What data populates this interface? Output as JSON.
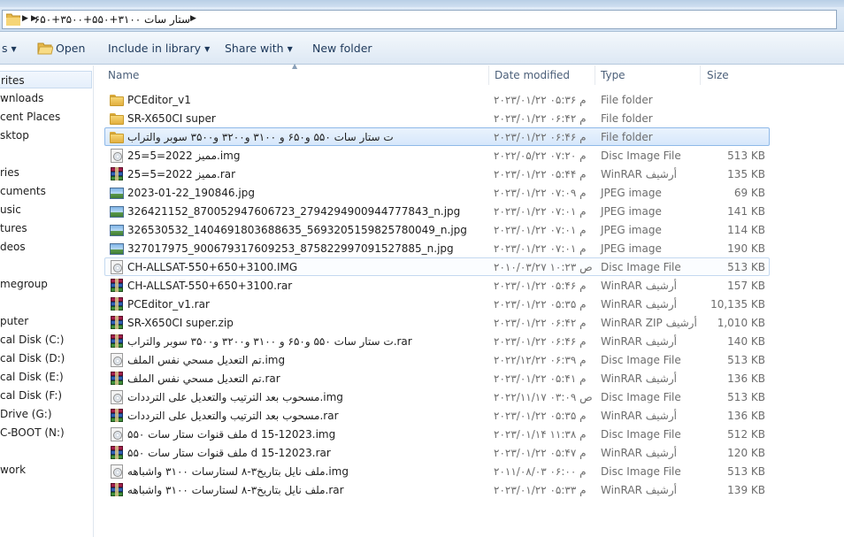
{
  "address_bar": {
    "path": "ستار سات ۳۱۰۰+۵۵۰+۳۵۰۰+۶۵۰"
  },
  "toolbar": {
    "partial_left_label": "s",
    "open_label": "Open",
    "include_label": "Include in library",
    "share_label": "Share with",
    "new_folder_label": "New folder"
  },
  "nav_pane": {
    "items": [
      {
        "label": "rites",
        "selected": true
      },
      {
        "label": "wnloads"
      },
      {
        "label": "cent Places"
      },
      {
        "label": "sktop"
      },
      {
        "label": ""
      },
      {
        "label": "ries"
      },
      {
        "label": "cuments"
      },
      {
        "label": "usic"
      },
      {
        "label": "tures"
      },
      {
        "label": "deos"
      },
      {
        "label": ""
      },
      {
        "label": "megroup"
      },
      {
        "label": ""
      },
      {
        "label": "puter"
      },
      {
        "label": "cal Disk (C:)"
      },
      {
        "label": "cal Disk (D:)"
      },
      {
        "label": "cal Disk (E:)"
      },
      {
        "label": "cal Disk (F:)"
      },
      {
        "label": "Drive (G:)"
      },
      {
        "label": "C-BOOT (N:)"
      },
      {
        "label": ""
      },
      {
        "label": "work"
      }
    ]
  },
  "columns": {
    "name": "Name",
    "date": "Date modified",
    "type": "Type",
    "size": "Size"
  },
  "files": [
    {
      "icon": "folder",
      "name": "PCEditor_v1",
      "date": "۲۰۲۳/۰۱/۲۲ م ۰۵:۳۶",
      "type": "File folder",
      "size": ""
    },
    {
      "icon": "folder",
      "name": "SR-X650CI super",
      "date": "۲۰۲۳/۰۱/۲۲ م ۰۶:۴۲",
      "type": "File folder",
      "size": ""
    },
    {
      "icon": "folder",
      "name": "ت ستار سات ۵۵۰ و۶۵۰ و ۳۱۰۰ و۳۲۰۰ و۳۵۰۰ سوبر والتراب",
      "date": "۲۰۲۳/۰۱/۲۲ م ۰۶:۴۶",
      "type": "File folder",
      "size": "",
      "state": "selected"
    },
    {
      "icon": "disc",
      "name": "مميز 2022=5=25.img",
      "date": "۲۰۲۲/۰۵/۲۲ م ۰۷:۲۰",
      "type": "Disc Image File",
      "size": "513 KB"
    },
    {
      "icon": "rar",
      "name": "مميز 2022=5=25.rar",
      "date": "۲۰۲۳/۰۱/۲۲ م ۰۵:۴۴",
      "type": "WinRAR أرشيف",
      "size": "135 KB"
    },
    {
      "icon": "jpg",
      "name": "2023-01-22_190846.jpg",
      "date": "۲۰۲۳/۰۱/۲۲ م ۰۷:۰۹",
      "type": "JPEG image",
      "size": "69 KB"
    },
    {
      "icon": "jpg",
      "name": "326421152_870052947606723_2794294900944777843_n.jpg",
      "date": "۲۰۲۳/۰۱/۲۲ م ۰۷:۰۱",
      "type": "JPEG image",
      "size": "141 KB"
    },
    {
      "icon": "jpg",
      "name": "326530532_1404691803688635_5693205159825780049_n.jpg",
      "date": "۲۰۲۳/۰۱/۲۲ م ۰۷:۰۱",
      "type": "JPEG image",
      "size": "114 KB"
    },
    {
      "icon": "jpg",
      "name": "327017975_900679317609253_875822997091527885_n.jpg",
      "date": "۲۰۲۳/۰۱/۲۲ م ۰۷:۰۱",
      "type": "JPEG image",
      "size": "190 KB"
    },
    {
      "icon": "disc",
      "name": "CH-ALLSAT-550+650+3100.IMG",
      "date": "۲۰۱۰/۰۳/۲۷ ص ۱۰:۲۳",
      "type": "Disc Image File",
      "size": "513 KB",
      "state": "hover"
    },
    {
      "icon": "rar",
      "name": "CH-ALLSAT-550+650+3100.rar",
      "date": "۲۰۲۳/۰۱/۲۲ م ۰۵:۴۶",
      "type": "WinRAR أرشيف",
      "size": "157 KB"
    },
    {
      "icon": "rar",
      "name": "PCEditor_v1.rar",
      "date": "۲۰۲۳/۰۱/۲۲ م ۰۵:۳۵",
      "type": "WinRAR أرشيف",
      "size": "10,135 KB"
    },
    {
      "icon": "rar",
      "name": "SR-X650CI super.zip",
      "date": "۲۰۲۳/۰۱/۲۲ م ۰۶:۴۲",
      "type": "WinRAR ZIP أرشيف",
      "size": "1,010 KB"
    },
    {
      "icon": "rar",
      "name": "ت ستار سات ۵۵۰ و۶۵۰ و ۳۱۰۰ و۳۲۰۰ و۳۵۰۰ سوبر والتراب.rar",
      "date": "۲۰۲۳/۰۱/۲۲ م ۰۶:۴۶",
      "type": "WinRAR أرشيف",
      "size": "140 KB"
    },
    {
      "icon": "disc",
      "name": "تم التعديل مسحي نفس الملف.img",
      "date": "۲۰۲۲/۱۲/۲۲ م ۰۶:۳۹",
      "type": "Disc Image File",
      "size": "513 KB"
    },
    {
      "icon": "rar",
      "name": "تم التعديل مسحي نفس الملف.rar",
      "date": "۲۰۲۳/۰۱/۲۲ م ۰۵:۴۱",
      "type": "WinRAR أرشيف",
      "size": "136 KB"
    },
    {
      "icon": "disc",
      "name": "مسحوب بعد الترتيب والتعديل على الترددات.img",
      "date": "۲۰۲۲/۱۱/۱۷ ص ۰۳:۰۹",
      "type": "Disc Image File",
      "size": "513 KB"
    },
    {
      "icon": "rar",
      "name": "مسحوب بعد الترتيب والتعديل على الترددات.rar",
      "date": "۲۰۲۳/۰۱/۲۲ م ۰۵:۳۵",
      "type": "WinRAR أرشيف",
      "size": "136 KB"
    },
    {
      "icon": "disc",
      "name": "ملف قنوات ستار سات ۵۵۰ d 15-12023.img",
      "date": "۲۰۲۳/۰۱/۱۴ م ۱۱:۳۸",
      "type": "Disc Image File",
      "size": "512 KB"
    },
    {
      "icon": "rar",
      "name": "ملف قنوات ستار سات ۵۵۰ d 15-12023.rar",
      "date": "۲۰۲۳/۰۱/۲۲ م ۰۵:۴۷",
      "type": "WinRAR أرشيف",
      "size": "120 KB"
    },
    {
      "icon": "disc",
      "name": "ملف نايل بتاريخ۳-۸ لستارسات ۳۱۰۰ واشباهه.img",
      "date": "۲۰۱۱/۰۸/۰۳ م ۰۶:۰۰",
      "type": "Disc Image File",
      "size": "513 KB"
    },
    {
      "icon": "rar",
      "name": "ملف نايل بتاريخ۳-۸ لستارسات ۳۱۰۰ واشباهه.rar",
      "date": "۲۰۲۳/۰۱/۲۲ م ۰۵:۳۳",
      "type": "WinRAR أرشيف",
      "size": "139 KB"
    }
  ],
  "colors": {
    "selection_border": "#8fb9e8",
    "toolbar_text": "#1e395b",
    "header_text": "#4c607a"
  }
}
